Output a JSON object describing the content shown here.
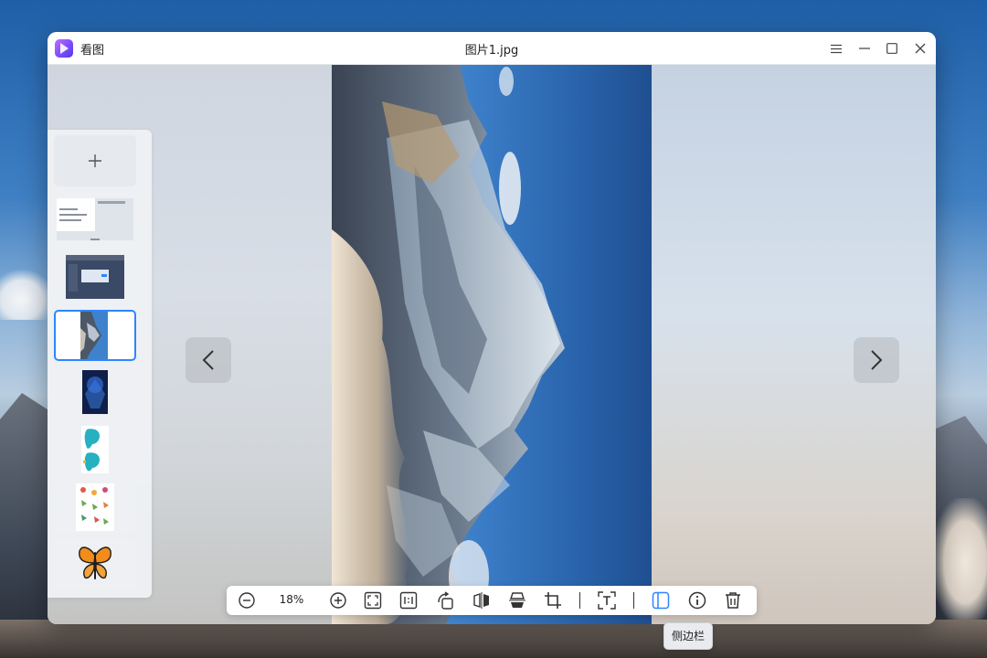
{
  "window": {
    "app_name": "看图",
    "title": "图片1.jpg"
  },
  "toolbar": {
    "zoom": "18%"
  },
  "tooltip": {
    "text": "侧边栏"
  },
  "icons": {
    "app": "image-viewer-logo-icon",
    "menu": "hamburger-menu-icon",
    "minimize": "minimize-icon",
    "maximize": "maximize-icon",
    "close": "close-icon",
    "add": "plus-icon",
    "prev": "chevron-left-icon",
    "next": "chevron-right-icon",
    "zoom_out": "zoom-out-icon",
    "zoom_in": "zoom-in-icon",
    "fit": "fit-window-icon",
    "actual": "actual-size-icon",
    "rotate": "rotate-icon",
    "flip_h": "flip-horizontal-icon",
    "flip_v": "flip-vertical-icon",
    "crop": "crop-icon",
    "ocr": "text-recognition-icon",
    "sidebar": "sidebar-icon",
    "info": "info-icon",
    "delete": "trash-icon"
  },
  "colors": {
    "accent": "#2d86ff",
    "logo_start": "#c26cff",
    "logo_end": "#5a36e0"
  }
}
